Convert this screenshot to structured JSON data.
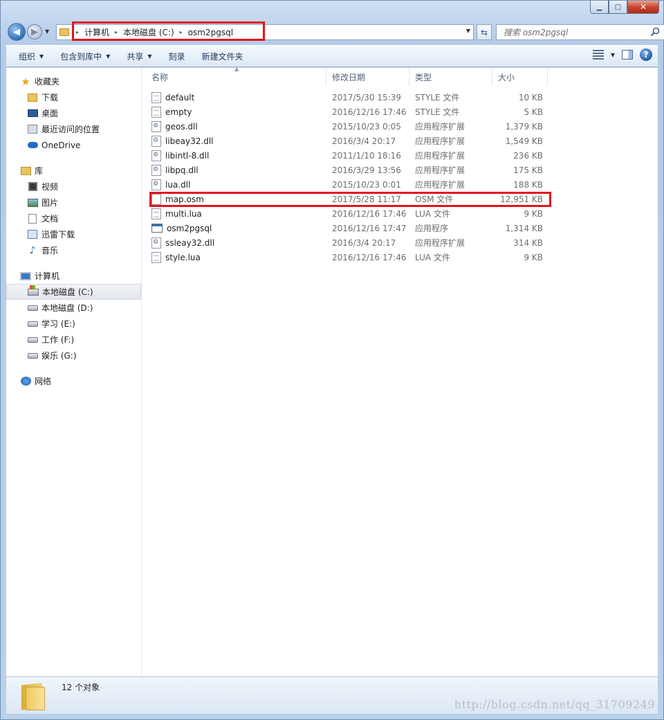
{
  "window": {
    "caption_buttons": {
      "minimize": "▁",
      "maximize": "□",
      "close": "✕"
    }
  },
  "address": {
    "crumbs": [
      "计算机",
      "本地磁盘 (C:)",
      "osm2pgsql"
    ],
    "search_placeholder": "搜索 osm2pgsql"
  },
  "toolbar": {
    "organize": "组织",
    "include_in_library": "包含到库中",
    "share": "共享",
    "burn": "刻录",
    "new_folder": "新建文件夹"
  },
  "sidebar": {
    "favorites": {
      "label": "收藏夹",
      "items": [
        "下载",
        "桌面",
        "最近访问的位置",
        "OneDrive"
      ]
    },
    "libraries": {
      "label": "库",
      "items": [
        "视频",
        "图片",
        "文档",
        "迅雷下载",
        "音乐"
      ]
    },
    "computer": {
      "label": "计算机",
      "items": [
        "本地磁盘 (C:)",
        "本地磁盘 (D:)",
        "学习 (E:)",
        "工作 (F:)",
        "娱乐 (G:)"
      ],
      "selected_index": 0
    },
    "network": {
      "label": "网络"
    }
  },
  "columns": {
    "name": "名称",
    "date": "修改日期",
    "type": "类型",
    "size": "大小"
  },
  "files": [
    {
      "name": "default",
      "date": "2017/5/30 15:39",
      "type": "STYLE 文件",
      "size": "10 KB",
      "icon": "text-file-icon"
    },
    {
      "name": "empty",
      "date": "2016/12/16 17:46",
      "type": "STYLE 文件",
      "size": "5 KB",
      "icon": "text-file-icon"
    },
    {
      "name": "geos.dll",
      "date": "2015/10/23 0:05",
      "type": "应用程序扩展",
      "size": "1,379 KB",
      "icon": "dll-file-icon"
    },
    {
      "name": "libeay32.dll",
      "date": "2016/3/4 20:17",
      "type": "应用程序扩展",
      "size": "1,549 KB",
      "icon": "dll-file-icon"
    },
    {
      "name": "libintl-8.dll",
      "date": "2011/1/10 18:16",
      "type": "应用程序扩展",
      "size": "236 KB",
      "icon": "dll-file-icon"
    },
    {
      "name": "libpq.dll",
      "date": "2016/3/29 13:56",
      "type": "应用程序扩展",
      "size": "175 KB",
      "icon": "dll-file-icon"
    },
    {
      "name": "lua.dll",
      "date": "2015/10/23 0:01",
      "type": "应用程序扩展",
      "size": "188 KB",
      "icon": "dll-file-icon"
    },
    {
      "name": "map.osm",
      "date": "2017/5/28 11:17",
      "type": "OSM 文件",
      "size": "12,951 KB",
      "icon": "blank-file-icon"
    },
    {
      "name": "multi.lua",
      "date": "2016/12/16 17:46",
      "type": "LUA 文件",
      "size": "9 KB",
      "icon": "text-file-icon"
    },
    {
      "name": "osm2pgsql",
      "date": "2016/12/16 17:47",
      "type": "应用程序",
      "size": "1,314 KB",
      "icon": "exe-file-icon"
    },
    {
      "name": "ssleay32.dll",
      "date": "2016/3/4 20:17",
      "type": "应用程序扩展",
      "size": "314 KB",
      "icon": "dll-file-icon"
    },
    {
      "name": "style.lua",
      "date": "2016/12/16 17:46",
      "type": "LUA 文件",
      "size": "9 KB",
      "icon": "text-file-icon"
    }
  ],
  "status": {
    "text": "12 个对象"
  },
  "watermark": "http://blog.csdn.net/qq_31709249",
  "colors": {
    "highlight": "#e3131d",
    "accent": "#2b5fa2"
  }
}
